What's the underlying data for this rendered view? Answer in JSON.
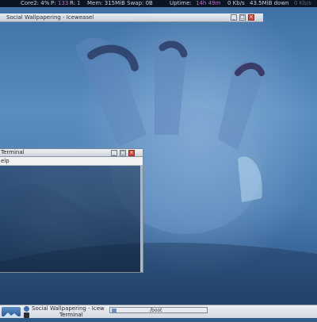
{
  "statusbar": {
    "core2": "Core2: 4%",
    "procs_label": "P:",
    "procs_value": "133",
    "running_label": "R:",
    "running_value": "1",
    "mem": "Mem: 315MiB Swap: 0B",
    "uptime_label": "Uptime:",
    "uptime_value": "14h 49m",
    "net_up": "0 Kb/s",
    "net_down": "43.5MiB down",
    "net_tail": "0 Kb/s"
  },
  "iceweasel": {
    "title": "Social Wallpapering - Iceweasel"
  },
  "terminal": {
    "title": "Terminal",
    "menu_fragment": "elp"
  },
  "taskbar": {
    "window1_label": "Social Wallpapering - Icew",
    "window2_label": "Terminal",
    "path_label": "/boot"
  },
  "colors": {
    "statusbar_bg": "#0b1422",
    "highlight_purple": "#b070c0",
    "highlight_green": "#7ccf6a",
    "close_button": "#c84a3a"
  }
}
